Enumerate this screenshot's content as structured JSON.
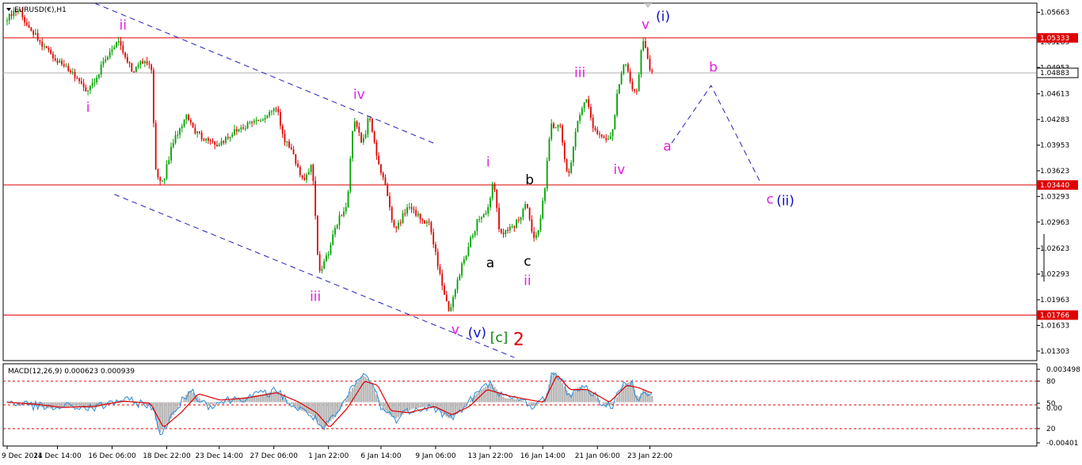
{
  "window": {
    "symbol_title": "EURUSD(€),H1",
    "indicator_title": "MACD(12,26,9) 0.000623 0.000939"
  },
  "colors": {
    "background": "#ffffff",
    "bull_candle": "#00a000",
    "bear_candle": "#e00000",
    "horizontal_lines": "#e00000",
    "current_price_line": "#b0b0b0",
    "channel_lines": "#2020c0",
    "projection_line": "#2020c0",
    "macd_histogram": "#b8b8b8",
    "macd_line": "#2a8ad6",
    "signal_line": "#e00000",
    "level_tag": "#e00000",
    "magenta_label": "#e020e0",
    "blue_label": "#1010c0",
    "black_label": "#000000",
    "green_label": "#108010",
    "red_label": "#e00000"
  },
  "chart_data": [
    {
      "type": "candlestick",
      "symbol": "EURUSD(€)",
      "timeframe": "H1",
      "x_tick_labels": [
        "9 Dec 2024",
        "11 Dec 14:00",
        "16 Dec 06:00",
        "18 Dec 22:00",
        "23 Dec 14:00",
        "27 Dec 06:00",
        "1 Jan 22:00",
        "6 Jan 14:00",
        "9 Jan 06:00",
        "13 Jan 22:00",
        "16 Jan 14:00",
        "21 Jan 06:00",
        "23 Jan 22:00"
      ],
      "y_tick_labels": [
        "1.05663",
        "1.05283",
        "1.04953",
        "1.04613",
        "1.04283",
        "1.03953",
        "1.03623",
        "1.03293",
        "1.02963",
        "1.02623",
        "1.02293",
        "1.01963",
        "1.01633",
        "1.01303"
      ],
      "ylim": [
        1.0118,
        1.0578
      ],
      "horizontal_levels": [
        {
          "value": 1.05333,
          "label": "1.05333"
        },
        {
          "value": 1.0344,
          "label": "1.03440"
        },
        {
          "value": 1.01766,
          "label": "1.01766"
        }
      ],
      "current_price": {
        "value": 1.04883,
        "label": "1.04883"
      },
      "price_path": [
        {
          "x": 0,
          "y": 1.0555
        },
        {
          "x": 5,
          "y": 1.0572
        },
        {
          "x": 10,
          "y": 1.0548
        },
        {
          "x": 20,
          "y": 1.0512
        },
        {
          "x": 30,
          "y": 1.0488
        },
        {
          "x": 37,
          "y": 1.0462
        },
        {
          "x": 44,
          "y": 1.0498
        },
        {
          "x": 51,
          "y": 1.0528
        },
        {
          "x": 58,
          "y": 1.0492
        },
        {
          "x": 64,
          "y": 1.0505
        },
        {
          "x": 67,
          "y": 1.0486
        },
        {
          "x": 68,
          "y": 1.0362
        },
        {
          "x": 72,
          "y": 1.0348
        },
        {
          "x": 76,
          "y": 1.0398
        },
        {
          "x": 82,
          "y": 1.0432
        },
        {
          "x": 88,
          "y": 1.0408
        },
        {
          "x": 96,
          "y": 1.0395
        },
        {
          "x": 104,
          "y": 1.0412
        },
        {
          "x": 112,
          "y": 1.0425
        },
        {
          "x": 118,
          "y": 1.0432
        },
        {
          "x": 124,
          "y": 1.0445
        },
        {
          "x": 127,
          "y": 1.0405
        },
        {
          "x": 131,
          "y": 1.0385
        },
        {
          "x": 136,
          "y": 1.0345
        },
        {
          "x": 140,
          "y": 1.0372
        },
        {
          "x": 143,
          "y": 1.0228
        },
        {
          "x": 147,
          "y": 1.0255
        },
        {
          "x": 152,
          "y": 1.0298
        },
        {
          "x": 156,
          "y": 1.0318
        },
        {
          "x": 159,
          "y": 1.0435
        },
        {
          "x": 163,
          "y": 1.0395
        },
        {
          "x": 166,
          "y": 1.0432
        },
        {
          "x": 170,
          "y": 1.0375
        },
        {
          "x": 174,
          "y": 1.0338
        },
        {
          "x": 178,
          "y": 1.0282
        },
        {
          "x": 183,
          "y": 1.0315
        },
        {
          "x": 188,
          "y": 1.0305
        },
        {
          "x": 194,
          "y": 1.0292
        },
        {
          "x": 197,
          "y": 1.0248
        },
        {
          "x": 200,
          "y": 1.0212
        },
        {
          "x": 203,
          "y": 1.0178
        },
        {
          "x": 208,
          "y": 1.0238
        },
        {
          "x": 212,
          "y": 1.0268
        },
        {
          "x": 216,
          "y": 1.0302
        },
        {
          "x": 220,
          "y": 1.0308
        },
        {
          "x": 223,
          "y": 1.0352
        },
        {
          "x": 226,
          "y": 1.0278
        },
        {
          "x": 230,
          "y": 1.0285
        },
        {
          "x": 234,
          "y": 1.0298
        },
        {
          "x": 238,
          "y": 1.0318
        },
        {
          "x": 242,
          "y": 1.0268
        },
        {
          "x": 246,
          "y": 1.0328
        },
        {
          "x": 249,
          "y": 1.0418
        },
        {
          "x": 253,
          "y": 1.0425
        },
        {
          "x": 257,
          "y": 1.0348
        },
        {
          "x": 261,
          "y": 1.0418
        },
        {
          "x": 265,
          "y": 1.0458
        },
        {
          "x": 269,
          "y": 1.0412
        },
        {
          "x": 273,
          "y": 1.0408
        },
        {
          "x": 277,
          "y": 1.0402
        },
        {
          "x": 280,
          "y": 1.0472
        },
        {
          "x": 283,
          "y": 1.0508
        },
        {
          "x": 286,
          "y": 1.0468
        },
        {
          "x": 289,
          "y": 1.0468
        },
        {
          "x": 291,
          "y": 1.0532
        },
        {
          "x": 293,
          "y": 1.0512
        },
        {
          "x": 295,
          "y": 1.0488
        }
      ],
      "projection_path": [
        {
          "x": 304,
          "y": 1.0398
        },
        {
          "x": 322,
          "y": 1.0472
        },
        {
          "x": 345,
          "y": 1.0345
        }
      ],
      "channel_lines": [
        {
          "from": {
            "x": 40,
            "y": 1.0578
          },
          "to": {
            "x": 195,
            "y": 1.0398
          }
        },
        {
          "from": {
            "x": 49,
            "y": 1.0332
          },
          "to": {
            "x": 232,
            "y": 1.0122
          }
        }
      ],
      "wave_labels": [
        {
          "text": "ii",
          "x": 53,
          "y": 1.0544,
          "color": "#e020e0"
        },
        {
          "text": "i",
          "x": 37,
          "y": 1.0438,
          "color": "#e020e0"
        },
        {
          "text": "iv",
          "x": 161,
          "y": 1.0455,
          "color": "#e020e0"
        },
        {
          "text": "iii",
          "x": 141,
          "y": 1.0195,
          "color": "#e020e0"
        },
        {
          "text": "v",
          "x": 205,
          "y": 1.0152,
          "color": "#e020e0"
        },
        {
          "text": "(v)",
          "x": 215,
          "y": 1.0148,
          "color": "#1010c0"
        },
        {
          "text": "[c]",
          "x": 225,
          "y": 1.0142,
          "color": "#108010"
        },
        {
          "text": "2",
          "x": 234,
          "y": 1.0138,
          "color": "#e00000"
        },
        {
          "text": "i",
          "x": 220,
          "y": 1.0368,
          "color": "#e020e0"
        },
        {
          "text": "a",
          "x": 221,
          "y": 1.0238,
          "color": "#000000"
        },
        {
          "text": "b",
          "x": 239,
          "y": 1.0345,
          "color": "#000000"
        },
        {
          "text": "c",
          "x": 238,
          "y": 1.024,
          "color": "#000000"
        },
        {
          "text": "ii",
          "x": 238,
          "y": 1.0215,
          "color": "#e020e0"
        },
        {
          "text": "iii",
          "x": 262,
          "y": 1.0483,
          "color": "#e020e0"
        },
        {
          "text": "iv",
          "x": 280,
          "y": 1.0358,
          "color": "#e020e0"
        },
        {
          "text": "v",
          "x": 292,
          "y": 1.0545,
          "color": "#e020e0"
        },
        {
          "text": "(i)",
          "x": 300,
          "y": 1.0555,
          "color": "#1010c0"
        },
        {
          "text": "a",
          "x": 302,
          "y": 1.0388,
          "color": "#e020e0"
        },
        {
          "text": "b",
          "x": 323,
          "y": 1.049,
          "color": "#e020e0"
        },
        {
          "text": "c",
          "x": 349,
          "y": 1.032,
          "color": "#e020e0"
        },
        {
          "text": "(ii)",
          "x": 356,
          "y": 1.0318,
          "color": "#1010c0"
        }
      ]
    },
    {
      "type": "macd",
      "parameters": "12,26,9",
      "macd_value": 0.000623,
      "signal_value": 0.000939,
      "y_tick_labels": [
        "0.003498",
        "80",
        "50",
        "0.00",
        "20",
        "-0.00401"
      ],
      "level_lines": [
        80,
        50,
        20
      ],
      "ylim": [
        -0.00401,
        0.003498
      ],
      "macd_path": [
        {
          "x": 0,
          "y": 0.0001
        },
        {
          "x": 12,
          "y": -0.0003
        },
        {
          "x": 20,
          "y": -0.0006
        },
        {
          "x": 30,
          "y": -0.0004
        },
        {
          "x": 40,
          "y": -0.0006
        },
        {
          "x": 52,
          "y": 0.0002
        },
        {
          "x": 62,
          "y": -0.0001
        },
        {
          "x": 67,
          "y": -0.0004
        },
        {
          "x": 70,
          "y": -0.003
        },
        {
          "x": 76,
          "y": -0.0014
        },
        {
          "x": 84,
          "y": 0.0012
        },
        {
          "x": 92,
          "y": -0.0003
        },
        {
          "x": 104,
          "y": 0.0003
        },
        {
          "x": 116,
          "y": 0.0007
        },
        {
          "x": 124,
          "y": 0.0011
        },
        {
          "x": 132,
          "y": -0.0005
        },
        {
          "x": 140,
          "y": -0.0012
        },
        {
          "x": 145,
          "y": -0.0026
        },
        {
          "x": 152,
          "y": -0.001
        },
        {
          "x": 158,
          "y": 0.0012
        },
        {
          "x": 163,
          "y": 0.0026
        },
        {
          "x": 167,
          "y": 0.002
        },
        {
          "x": 172,
          "y": -0.0006
        },
        {
          "x": 178,
          "y": -0.0016
        },
        {
          "x": 186,
          "y": -0.0006
        },
        {
          "x": 194,
          "y": -0.0004
        },
        {
          "x": 198,
          "y": -0.0008
        },
        {
          "x": 203,
          "y": -0.0016
        },
        {
          "x": 210,
          "y": -0.0004
        },
        {
          "x": 216,
          "y": 0.001
        },
        {
          "x": 222,
          "y": 0.0018
        },
        {
          "x": 228,
          "y": 0.0004
        },
        {
          "x": 236,
          "y": 0.0002
        },
        {
          "x": 242,
          "y": -0.0004
        },
        {
          "x": 247,
          "y": 0.0004
        },
        {
          "x": 250,
          "y": 0.003
        },
        {
          "x": 254,
          "y": 0.002
        },
        {
          "x": 258,
          "y": 0.0006
        },
        {
          "x": 262,
          "y": 0.0015
        },
        {
          "x": 268,
          "y": 0.001
        },
        {
          "x": 274,
          "y": -0.0004
        },
        {
          "x": 278,
          "y": -0.0002
        },
        {
          "x": 282,
          "y": 0.0016
        },
        {
          "x": 286,
          "y": 0.002
        },
        {
          "x": 289,
          "y": 0.0004
        },
        {
          "x": 292,
          "y": 0.0013
        },
        {
          "x": 295,
          "y": 0.0006
        }
      ],
      "signal_path": [
        {
          "x": 0,
          "y": 0.0
        },
        {
          "x": 14,
          "y": -0.0002
        },
        {
          "x": 26,
          "y": -0.0005
        },
        {
          "x": 40,
          "y": -0.0004
        },
        {
          "x": 54,
          "y": 0.0001
        },
        {
          "x": 66,
          "y": -0.0001
        },
        {
          "x": 72,
          "y": -0.0024
        },
        {
          "x": 80,
          "y": -0.001
        },
        {
          "x": 88,
          "y": 0.0008
        },
        {
          "x": 98,
          "y": 0.0002
        },
        {
          "x": 110,
          "y": 0.0004
        },
        {
          "x": 124,
          "y": 0.0009
        },
        {
          "x": 134,
          "y": 0.0
        },
        {
          "x": 142,
          "y": -0.001
        },
        {
          "x": 148,
          "y": -0.0024
        },
        {
          "x": 156,
          "y": -0.0006
        },
        {
          "x": 164,
          "y": 0.002
        },
        {
          "x": 170,
          "y": 0.0016
        },
        {
          "x": 176,
          "y": -0.0008
        },
        {
          "x": 184,
          "y": -0.001
        },
        {
          "x": 196,
          "y": -0.0004
        },
        {
          "x": 204,
          "y": -0.0012
        },
        {
          "x": 212,
          "y": -0.0004
        },
        {
          "x": 220,
          "y": 0.0012
        },
        {
          "x": 230,
          "y": 0.0006
        },
        {
          "x": 240,
          "y": 0.0002
        },
        {
          "x": 246,
          "y": 0.0
        },
        {
          "x": 252,
          "y": 0.0026
        },
        {
          "x": 258,
          "y": 0.0012
        },
        {
          "x": 266,
          "y": 0.0012
        },
        {
          "x": 276,
          "y": 0.0
        },
        {
          "x": 284,
          "y": 0.0016
        },
        {
          "x": 289,
          "y": 0.0014
        },
        {
          "x": 295,
          "y": 0.0009
        }
      ]
    }
  ]
}
